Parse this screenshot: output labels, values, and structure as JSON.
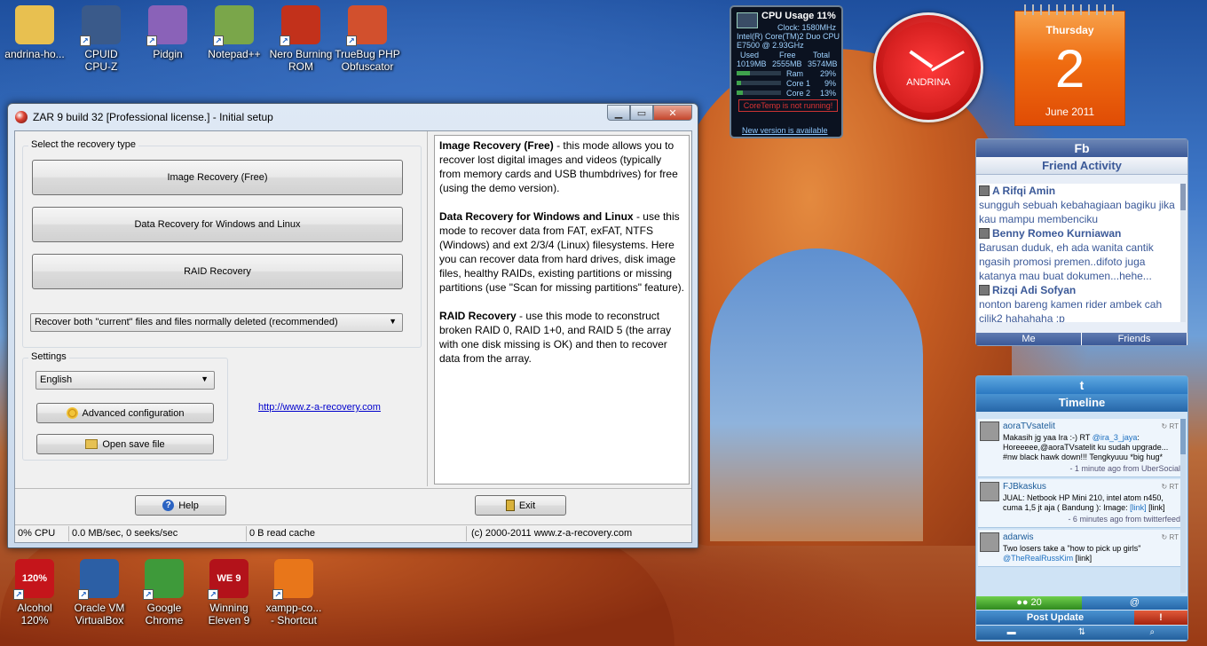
{
  "desktop_icons_top": [
    {
      "label": "andrina-ho...",
      "color": "#e8c050"
    },
    {
      "label": "CPUID\nCPU-Z",
      "color": "#3a5a8a"
    },
    {
      "label": "Pidgin",
      "color": "#8a62b8"
    },
    {
      "label": "Notepad++",
      "color": "#7aa64a"
    },
    {
      "label": "Nero Burning\nROM",
      "color": "#c2311b"
    },
    {
      "label": "TrueBug PHP\nObfuscator",
      "color": "#d2502d"
    }
  ],
  "desktop_icons_bottom": [
    {
      "label": "Alcohol\n120%",
      "badge": "120%",
      "color": "#c5151b"
    },
    {
      "label": "Oracle VM\nVirtualBox",
      "color": "#2c5fa5"
    },
    {
      "label": "Google\nChrome",
      "color": "#3e9a3a"
    },
    {
      "label": "Winning\nEleven 9",
      "badge": "WE 9",
      "color": "#b3121a"
    },
    {
      "label": "xampp-co...\n- Shortcut",
      "color": "#e8761a"
    }
  ],
  "window": {
    "title": "ZAR 9 build 32 [Professional license.] - Initial setup",
    "controls": {
      "minimize": "▁",
      "maximize": "▭",
      "close": "✕"
    },
    "recovery_group_label": "Select the recovery type",
    "image_recovery_button": "Image Recovery (Free)",
    "data_recovery_button": "Data Recovery for Windows and Linux",
    "raid_recovery_button": "RAID Recovery",
    "recovery_mode_select": "Recover both \"current\" files and files normally deleted (recommended)",
    "settings_group_label": "Settings",
    "language_select": "English",
    "advanced_button": "Advanced configuration",
    "open_save_button": "Open save file",
    "website_link": "http://www.z-a-recovery.com",
    "description": {
      "image_title": "Image Recovery (Free)",
      "image_text": " - this mode allows you to recover lost digital images and videos (typically from memory cards and USB thumbdrives) for free (using the demo version).",
      "data_title": "Data Recovery for Windows and Linux",
      "data_text": " - use this mode to recover data from FAT, exFAT, NTFS (Windows) and ext 2/3/4 (Linux) filesystems. Here you can recover data from hard drives, disk image files, healthy RAIDs, existing partitions or missing partitions (use \"Scan for missing partitions\" feature).",
      "raid_title": "RAID Recovery",
      "raid_text": " - use this mode to reconstruct broken RAID 0, RAID 1+0, and RAID 5 (the array with one disk missing is OK) and then to recover data from the array."
    },
    "help_button": "Help",
    "exit_button": "Exit",
    "status": {
      "cpu": "0% CPU",
      "io": "0.0 MB/sec, 0 seeks/sec",
      "cache": "0 B read cache",
      "copyright": "(c) 2000-2011 www.z-a-recovery.com"
    }
  },
  "cpu_gadget": {
    "title": "CPU Usage 11%",
    "clock": "Clock: 1580MHz",
    "cpu_name": "Intel(R) Core(TM)2 Duo CPU",
    "cpu_model": "E7500 @ 2.93GHz",
    "used_label": "Used",
    "free_label": "Free",
    "total_label": "Total",
    "used": "1019MB",
    "free": "2555MB",
    "total": "3574MB",
    "ram_label": "Ram",
    "ram_pct": "29%",
    "ram_value": 0.29,
    "core1_label": "Core 1",
    "core1_pct": "9%",
    "core1_value": 0.09,
    "core2_label": "Core 2",
    "core2_pct": "13%",
    "core2_value": 0.13,
    "warning": "CoreTemp is not running!",
    "new_version": "New version is available"
  },
  "clock_gadget": {
    "label": "ANDRINA",
    "hour": 10,
    "minute": 10
  },
  "calendar": {
    "day": "Thursday",
    "date": "2",
    "month": "June 2011"
  },
  "facebook": {
    "logo": "Fb",
    "title": "Friend Activity",
    "items": [
      {
        "name": "A Rifqi Amin",
        "msg": "sungguh sebuah kebahagiaan bagiku jika kau mampu membenciku"
      },
      {
        "name": "Benny Romeo Kurniawan",
        "msg": "Barusan duduk, eh ada wanita cantik ngasih promosi premen..difoto juga katanya mau buat dokumen...hehe..."
      },
      {
        "name": "Rizqi Adi Sofyan",
        "msg": "nonton bareng kamen rider ambek cah cilik2 hahahaha :p"
      }
    ],
    "tab_me": "Me",
    "tab_friends": "Friends"
  },
  "twitter": {
    "logo": "t",
    "title": "Timeline",
    "tweets": [
      {
        "name": "aoraTVsatelit",
        "text_before": "Makasih jg yaa Ira :-) RT ",
        "mention": "@ira_3_jaya",
        "text_after": ": Horeeeee,@aoraTVsatelit ku sudah upgrade... #nw black hawk down!!! Tengkyuuu *big hug*",
        "meta": "- 1 minute ago from UberSocial"
      },
      {
        "name": "FJBkaskus",
        "text_before": "JUAL: Netbook HP Mini 210, intel atom n450, cuma 1,5 jt aja ( Bandung ): Image: ",
        "mention": "[link]",
        "text_after": " [link]",
        "meta": "- 6 minutes ago from twitterfeed"
      },
      {
        "name": "adarwis",
        "text_before": "Two losers take a \"how to pick up girls\" ",
        "mention": "@TheRealRussKim",
        "text_after": " [link]",
        "meta": ""
      }
    ],
    "count": "20",
    "at": "@",
    "post_update": "Post Update",
    "alert": "!"
  }
}
